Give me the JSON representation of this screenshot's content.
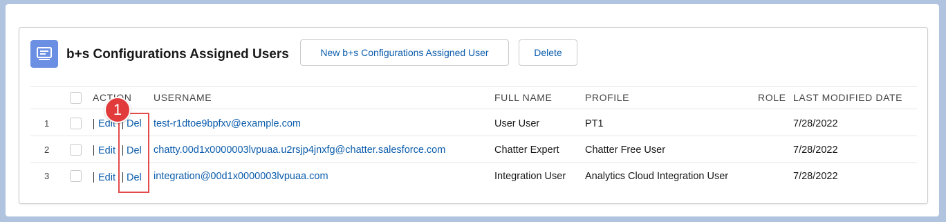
{
  "header": {
    "title": "b+s Configurations Assigned Users",
    "icon": "related-list-icon",
    "icon_color": "#6b8fe3"
  },
  "actions": {
    "new_label": "New b+s Configurations Assigned User",
    "delete_label": "Delete"
  },
  "columns": {
    "action": "ACTION",
    "username": "USERNAME",
    "full_name": "FULL NAME",
    "profile": "PROFILE",
    "role": "ROLE",
    "last_modified": "LAST MODIFIED DATE"
  },
  "rows": [
    {
      "num": "1",
      "edit": "Edit",
      "del": "Del",
      "username": "test-r1dtoe9bpfxv@example.com",
      "full_name": "User User",
      "profile": "PT1",
      "role": "",
      "last_modified": "7/28/2022"
    },
    {
      "num": "2",
      "edit": "Edit",
      "del": "Del",
      "username": "chatty.00d1x0000003lvpuaa.u2rsjp4jnxfg@chatter.salesforce.com",
      "full_name": "Chatter Expert",
      "profile": "Chatter Free User",
      "role": "",
      "last_modified": "7/28/2022"
    },
    {
      "num": "3",
      "edit": "Edit",
      "del": "Del",
      "username": "integration@00d1x0000003lvpuaa.com",
      "full_name": "Integration User",
      "profile": "Analytics Cloud Integration User",
      "role": "",
      "last_modified": "7/28/2022"
    }
  ],
  "callout": {
    "number": "1",
    "color": "#e23b3b"
  },
  "colors": {
    "link": "#0b5cab",
    "background": "#b0c4df"
  }
}
